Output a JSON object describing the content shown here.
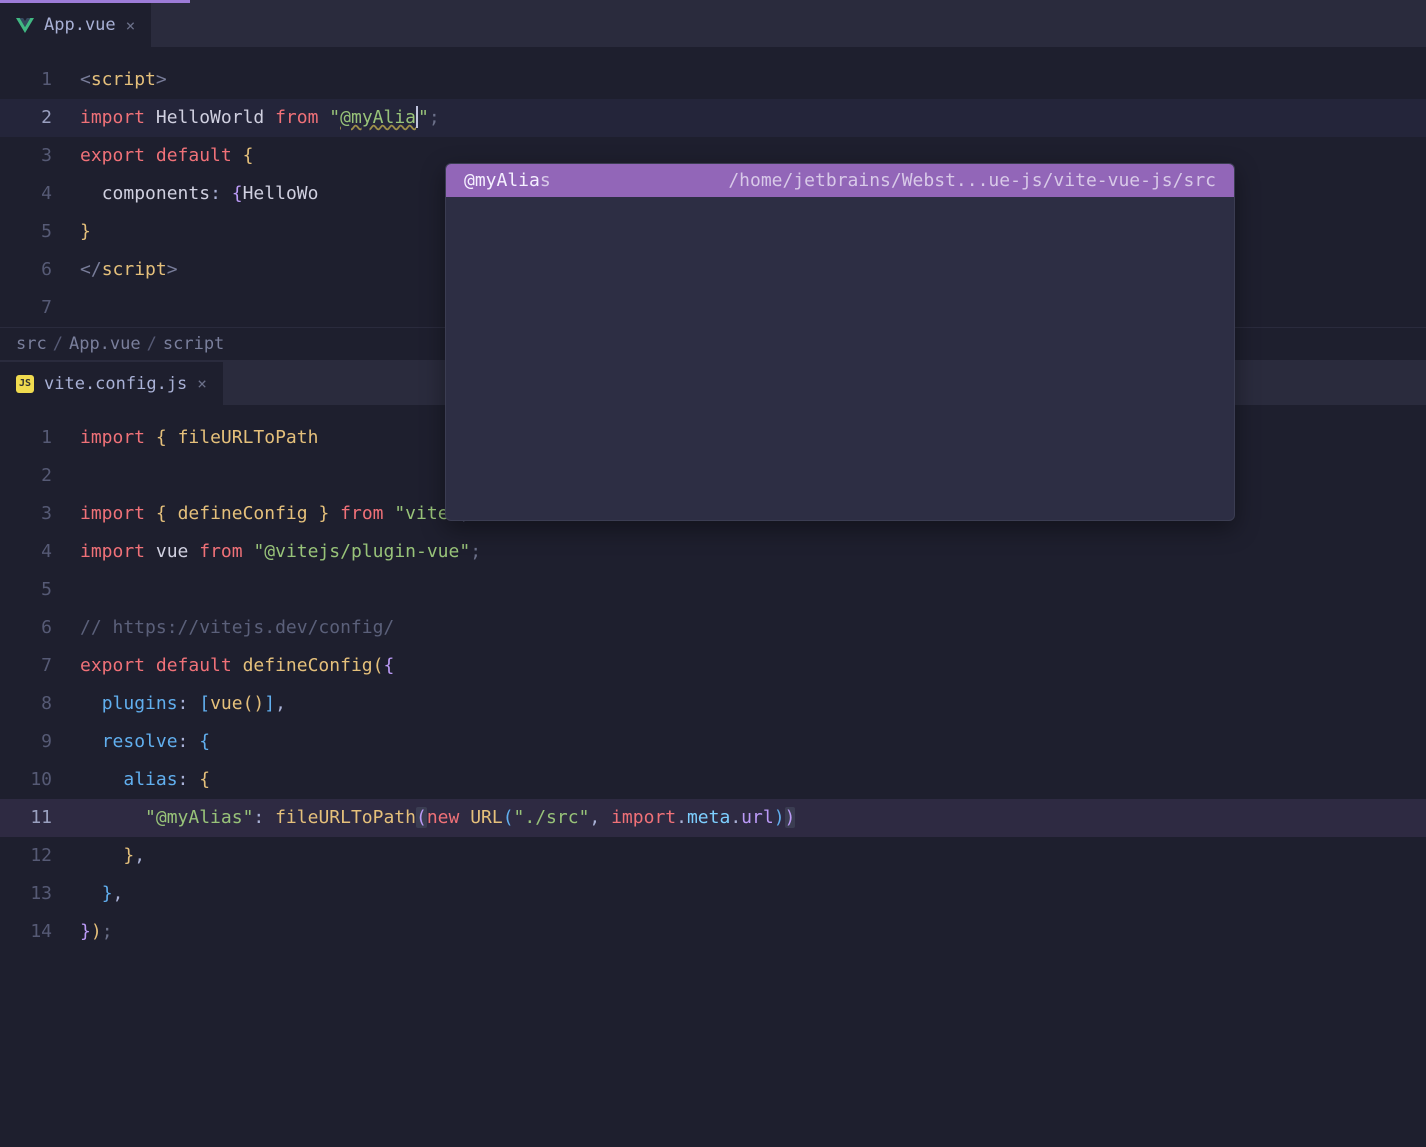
{
  "tabs": {
    "top": {
      "label": "App.vue"
    },
    "bottom": {
      "label": "vite.config.js",
      "badge": "JS"
    }
  },
  "breadcrumb": {
    "parts": [
      "src",
      "App.vue",
      "script"
    ]
  },
  "editor_top": {
    "lines": {
      "1": {
        "num": "1"
      },
      "2": {
        "num": "2",
        "import_kw": "import",
        "ident": "HelloWorld",
        "from_kw": "from",
        "str_prefix": "\"",
        "str_val": "@myAlia",
        "str_suffix": "\"",
        "semi": ";"
      },
      "3": {
        "num": "3",
        "export_kw": "export",
        "default_kw": "default",
        "brace": "{"
      },
      "4": {
        "num": "4",
        "prop": "components",
        "colon": ":",
        "brace": "{",
        "ident": "HelloWo"
      },
      "5": {
        "num": "5",
        "brace": "}"
      },
      "6": {
        "num": "6"
      },
      "7": {
        "num": "7"
      }
    },
    "script_tag": "script"
  },
  "editor_bottom": {
    "lines": {
      "1": {
        "num": "1",
        "import_kw": "import",
        "lbrace": "{",
        "ident": "fileURLToPath",
        "rbrace": "}"
      },
      "2": {
        "num": "2"
      },
      "3": {
        "num": "3",
        "import_kw": "import",
        "lbrace": "{",
        "ident": "defineConfig",
        "rbrace": "}",
        "from_kw": "from",
        "str": "\"vite\"",
        "semi": ";"
      },
      "4": {
        "num": "4",
        "import_kw": "import",
        "ident": "vue",
        "from_kw": "from",
        "str": "\"@vitejs/plugin-vue\"",
        "semi": ";"
      },
      "5": {
        "num": "5"
      },
      "6": {
        "num": "6",
        "comment": "// https://vitejs.dev/config/"
      },
      "7": {
        "num": "7",
        "export_kw": "export",
        "default_kw": "default",
        "fn": "defineConfig",
        "paren": "(",
        "brace": "{"
      },
      "8": {
        "num": "8",
        "prop": "plugins",
        "colon": ":",
        "lbr": "[",
        "fn": "vue",
        "parens": "()",
        "rbr": "]",
        "comma": ","
      },
      "9": {
        "num": "9",
        "prop": "resolve",
        "colon": ":",
        "brace": "{"
      },
      "10": {
        "num": "10",
        "prop": "alias",
        "colon": ":",
        "brace": "{"
      },
      "11": {
        "num": "11",
        "key": "\"@myAlias\"",
        "colon": ":",
        "fn": "fileURLToPath",
        "lparen": "(",
        "new_kw": "new",
        "cls": "URL",
        "lparen2": "(",
        "arg1": "\"./src\"",
        "comma": ",",
        "import_meta": "import",
        "dot1": ".",
        "meta": "meta",
        "dot2": ".",
        "url": "url",
        "rparen2": ")",
        "rparen": ")"
      },
      "12": {
        "num": "12",
        "brace": "}",
        "comma": ","
      },
      "13": {
        "num": "13",
        "brace": "}",
        "comma": ","
      },
      "14": {
        "num": "14",
        "brace": "}",
        "paren": ")",
        "semi": ";"
      }
    }
  },
  "autocomplete": {
    "match_prefix": "@myAlia",
    "match_suffix": "s",
    "path": "/home/jetbrains/Webst...ue-js/vite-vue-js/src"
  }
}
